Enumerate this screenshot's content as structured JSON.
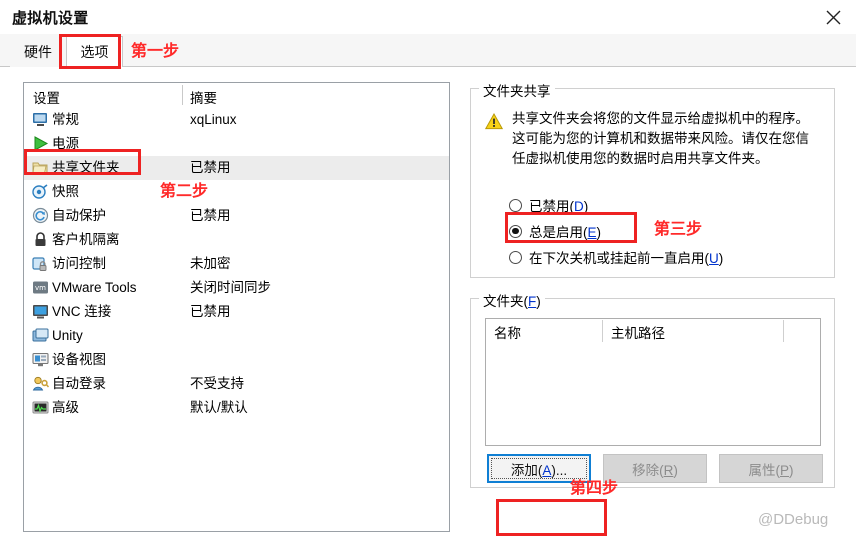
{
  "window": {
    "title": "虚拟机设置",
    "close_label": "✕"
  },
  "tabs": [
    {
      "label": "硬件",
      "active": false
    },
    {
      "label": "选项",
      "active": true
    }
  ],
  "settings_list": {
    "columns": [
      "设置",
      "摘要"
    ],
    "rows": [
      {
        "icon": "monitor-icon",
        "label": "常规",
        "summary": "xqLinux",
        "selected": false
      },
      {
        "icon": "play-icon",
        "label": "电源",
        "summary": "",
        "selected": false
      },
      {
        "icon": "folder-icon",
        "label": "共享文件夹",
        "summary": "已禁用",
        "selected": true
      },
      {
        "icon": "snapshot-icon",
        "label": "快照",
        "summary": "",
        "selected": false
      },
      {
        "icon": "autoprotect-icon",
        "label": "自动保护",
        "summary": "已禁用",
        "selected": false
      },
      {
        "icon": "lock-icon",
        "label": "客户机隔离",
        "summary": "",
        "selected": false
      },
      {
        "icon": "access-lock-icon",
        "label": "访问控制",
        "summary": "未加密",
        "selected": false
      },
      {
        "icon": "vmware-tools-icon",
        "label": "VMware Tools",
        "summary": "关闭时间同步",
        "selected": false
      },
      {
        "icon": "vnc-icon",
        "label": "VNC 连接",
        "summary": "已禁用",
        "selected": false
      },
      {
        "icon": "unity-icon",
        "label": "Unity",
        "summary": "",
        "selected": false
      },
      {
        "icon": "device-view-icon",
        "label": "设备视图",
        "summary": "",
        "selected": false
      },
      {
        "icon": "autologon-icon",
        "label": "自动登录",
        "summary": "不受支持",
        "selected": false
      },
      {
        "icon": "advanced-icon",
        "label": "高级",
        "summary": "默认/默认",
        "selected": false
      }
    ]
  },
  "sharing_group": {
    "legend": "文件夹共享",
    "warning_icon": "warning-triangle-icon",
    "warning_text": "共享文件夹会将您的文件显示给虚拟机中的程序。这可能为您的计算机和数据带来风险。请仅在您信任虚拟机使用您的数据时启用共享文件夹。",
    "options": [
      {
        "label": "已禁用(",
        "mnemonic": "D",
        "suffix": ")",
        "checked": false
      },
      {
        "label": "总是启用(",
        "mnemonic": "E",
        "suffix": ")",
        "checked": true
      },
      {
        "label": "在下次关机或挂起前一直启用(",
        "mnemonic": "U",
        "suffix": ")",
        "checked": false
      }
    ]
  },
  "folders_group": {
    "legend_prefix": "文件夹(",
    "legend_mnemonic": "F",
    "legend_suffix": ")",
    "table": {
      "columns": [
        "名称",
        "主机路径"
      ],
      "rows": []
    },
    "buttons": [
      {
        "label": "添加(",
        "mnemonic": "A",
        "suffix": ")...",
        "enabled": true,
        "focused": true
      },
      {
        "label": "移除(",
        "mnemonic": "R",
        "suffix": ")",
        "enabled": false,
        "focused": false
      },
      {
        "label": "属性(",
        "mnemonic": "P",
        "suffix": ")",
        "enabled": false,
        "focused": false
      }
    ]
  },
  "annotations": {
    "step1": "第一步",
    "step2": "第二步",
    "step3": "第三步",
    "step4": "第四步",
    "accent_color": "#ff2a2a"
  },
  "watermark": "@DDebug"
}
